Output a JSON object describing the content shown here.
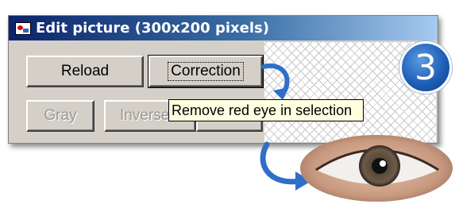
{
  "window": {
    "title": "Edit picture (300x200 pixels)"
  },
  "buttons": {
    "reload": "Reload",
    "correction": "Correction",
    "gray": "Gray",
    "inverse": "Inverse"
  },
  "tooltip": "Remove red eye in selection",
  "step_badge": "3",
  "colors": {
    "titlebar_start": "#0a246a",
    "titlebar_end": "#a6caf0",
    "arrow": "#2f6fc9",
    "badge": "#1f5fb8",
    "tooltip_bg": "#ffffe1"
  },
  "icons": [
    "picture-icon",
    "curved-arrow-icon",
    "eye-image"
  ]
}
